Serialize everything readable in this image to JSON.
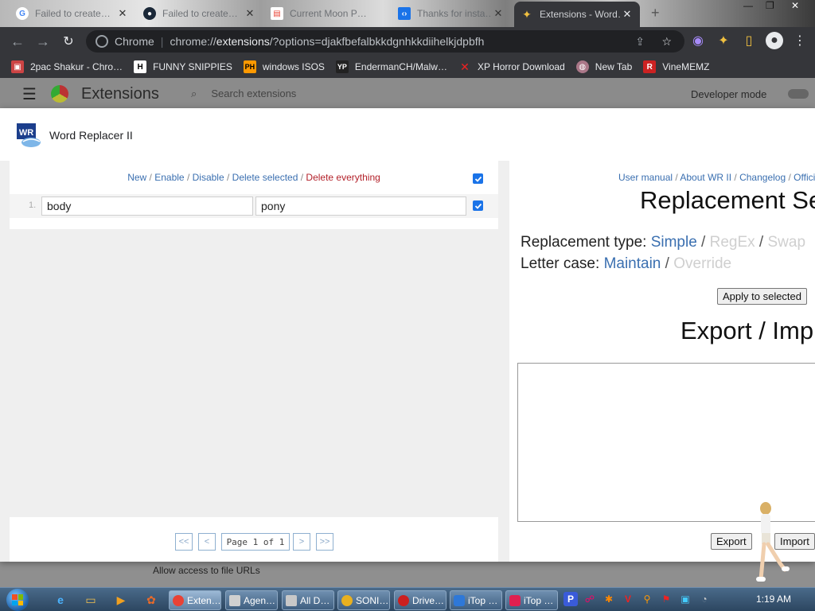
{
  "browser": {
    "tabs": [
      {
        "title": "Failed to create…",
        "icon": "google-icon"
      },
      {
        "title": "Failed to create…",
        "icon": "steam-icon"
      },
      {
        "title": "Current Moon P…",
        "icon": "google-doc-icon"
      },
      {
        "title": "Thanks for insta…",
        "icon": "extension-page-icon"
      },
      {
        "title": "Extensions - Word…",
        "icon": "puzzle-icon"
      }
    ],
    "omnibox": {
      "scheme_label": "Chrome",
      "url_prefix": "chrome://",
      "url_host": "extensions",
      "url_rest": "/?options=djakfbefalbkkdgnhkkdiihelkjdpbfh"
    },
    "bookmarks": [
      {
        "label": "2pac Shakur - Chro…",
        "icon": "bag-icon"
      },
      {
        "label": "FUNNY SNIPPIES",
        "icon": "h-icon"
      },
      {
        "label": "windows ISOS",
        "icon": "ph-icon"
      },
      {
        "label": "EndermanCH/Malw…",
        "icon": "yp-icon"
      },
      {
        "label": "XP Horror Download",
        "icon": "x-icon"
      },
      {
        "label": "New Tab",
        "icon": "globe-icon"
      },
      {
        "label": "VineMEMZ",
        "icon": "r-icon"
      }
    ]
  },
  "extensions_page": {
    "title": "Extensions",
    "search_placeholder": "Search extensions",
    "developer_mode": "Developer mode",
    "allow_file_urls": "Allow access to file URLs"
  },
  "dialog": {
    "title": "Word Replacer II",
    "list_actions": {
      "new": "New",
      "enable": "Enable",
      "disable": "Disable",
      "delete_selected": "Delete selected",
      "delete_everything": "Delete everything",
      "separator": " / "
    },
    "rows": [
      {
        "number": "1.",
        "find": "body",
        "replace": "pony",
        "checked": true
      }
    ],
    "pager": {
      "first": "<<",
      "prev": "<",
      "info": "Page 1 of 1",
      "next": ">",
      "last": ">>"
    },
    "top_links": {
      "user_manual": "User manual",
      "about": "About WR II",
      "changelog": "Changelog",
      "official": "Offici…"
    },
    "replacement_settings": {
      "heading": "Replacement Se…",
      "type_label": "Replacement type:",
      "type_simple": "Simple",
      "type_regex": "RegEx",
      "type_swap": "Swap",
      "case_label": "Letter case:",
      "case_maintain": "Maintain",
      "case_override": "Override",
      "apply_button": "Apply to selected"
    },
    "export_import": {
      "heading": "Export / Imp…",
      "textarea_value": "",
      "export_button": "Export",
      "import_button": "Import"
    }
  },
  "taskbar": {
    "buttons": [
      {
        "label": "Exten…",
        "color": "#e94235",
        "active": true
      },
      {
        "label": "Agen…",
        "color": "#d0d0d0",
        "active": false
      },
      {
        "label": "All D…",
        "color": "#c8c8c8",
        "active": false
      },
      {
        "label": "SONI…",
        "color": "#e8b020",
        "active": false
      },
      {
        "label": "Drive…",
        "color": "#cc2020",
        "active": false
      },
      {
        "label": "iTop …",
        "color": "#2e78d8",
        "active": false
      },
      {
        "label": "iTop …",
        "color": "#e02050",
        "active": false
      }
    ],
    "clock": "1:19 AM"
  },
  "colors": {
    "link": "#3a6fb0",
    "danger": "#b3212a",
    "checkbox": "#1a73e8",
    "disabled_option": "#cfcfcf"
  }
}
